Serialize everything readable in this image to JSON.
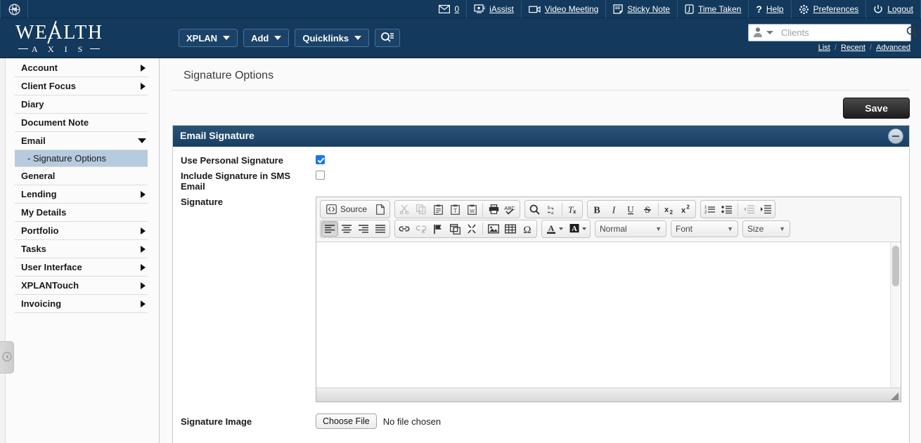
{
  "topbar": {
    "globe_icon": "globe-icon",
    "items": [
      {
        "icon": "envelope-icon",
        "label": "0",
        "name": "mail"
      },
      {
        "icon": "iassist-icon",
        "label": "iAssist",
        "name": "iassist"
      },
      {
        "icon": "video-icon",
        "label": "Video Meeting",
        "name": "video-meeting"
      },
      {
        "icon": "sticky-note-icon",
        "label": "Sticky Note",
        "name": "sticky-note"
      },
      {
        "icon": "clock-icon",
        "label": "Time Taken",
        "name": "time-taken"
      },
      {
        "icon": "question-icon",
        "label": "Help",
        "name": "help"
      },
      {
        "icon": "gear-icon",
        "label": "Preferences",
        "name": "preferences"
      },
      {
        "icon": "power-icon",
        "label": "Logout",
        "name": "logout"
      }
    ]
  },
  "brand": {
    "line1": "WEALTH",
    "line2": "A X I S"
  },
  "nav": {
    "buttons": [
      {
        "label": "XPLAN",
        "name": "xplan"
      },
      {
        "label": "Add",
        "name": "add"
      },
      {
        "label": "Quicklinks",
        "name": "quicklinks"
      }
    ],
    "search_icon": "search-list-icon"
  },
  "search": {
    "placeholder": "Clients",
    "value": "",
    "scope_icon": "person-icon",
    "links": [
      "List",
      "Recent",
      "Advanced"
    ]
  },
  "sidebar": {
    "items": [
      {
        "label": "Account",
        "arrow": "right"
      },
      {
        "label": "Client Focus",
        "arrow": "right"
      },
      {
        "label": "Diary",
        "arrow": "none"
      },
      {
        "label": "Document Note",
        "arrow": "none"
      },
      {
        "label": "Email",
        "arrow": "down"
      },
      {
        "label": "General",
        "arrow": "none"
      },
      {
        "label": "Lending",
        "arrow": "right"
      },
      {
        "label": "My Details",
        "arrow": "none"
      },
      {
        "label": "Portfolio",
        "arrow": "right"
      },
      {
        "label": "Tasks",
        "arrow": "right"
      },
      {
        "label": "User Interface",
        "arrow": "right"
      },
      {
        "label": "XPLANTouch",
        "arrow": "right"
      },
      {
        "label": "Invoicing",
        "arrow": "right"
      }
    ],
    "submenu": {
      "label": "- Signature Options",
      "selected": true
    },
    "collapse_icon": "arrow-left-circle-icon"
  },
  "main": {
    "page_title": "Signature Options",
    "save_label": "Save",
    "panel_title": "Email Signature",
    "collapse_icon": "minus-circle-icon"
  },
  "form": {
    "use_personal_signature": {
      "label": "Use Personal Signature",
      "checked": true
    },
    "include_sms": {
      "label": "Include Signature in SMS Email",
      "checked": false
    },
    "signature": {
      "label": "Signature"
    },
    "signature_image": {
      "label": "Signature Image",
      "button_label": "Choose File",
      "file_status": "No file chosen"
    }
  },
  "editor": {
    "source_label": "Source",
    "content": "",
    "dropdowns": [
      {
        "label": "Normal",
        "name": "paragraph-format"
      },
      {
        "label": "Font",
        "name": "font-family"
      },
      {
        "label": "Size",
        "name": "font-size"
      }
    ]
  },
  "colors": {
    "navy": "#13395c",
    "panel_header": "#1a4165",
    "accent_checkbox": "#1878f0",
    "submenu_selected": "#b7cbdf"
  }
}
